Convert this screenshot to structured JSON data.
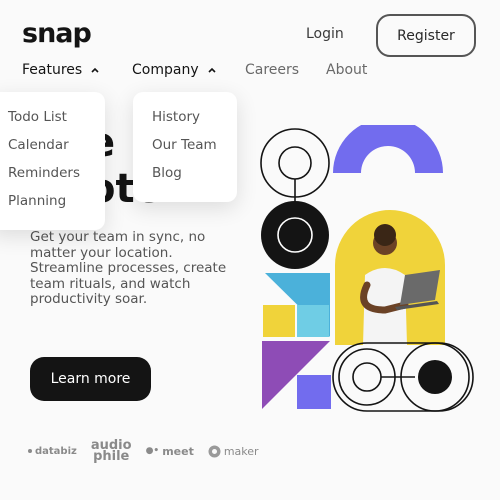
{
  "header": {
    "logo": "snap",
    "nav": {
      "features": "Features",
      "company": "Company",
      "careers": "Careers",
      "about": "About"
    },
    "login": "Login",
    "register": "Register"
  },
  "features_menu": {
    "items": [
      {
        "label": "Todo List",
        "icon": "todo-icon",
        "color": "#726cee"
      },
      {
        "label": "Calendar",
        "icon": "calendar-icon",
        "color": "#4bb1da"
      },
      {
        "label": "Reminders",
        "icon": "reminders-icon",
        "color": "#edd556"
      },
      {
        "label": "Planning",
        "icon": "planning-icon",
        "color": "#8e4cb6"
      }
    ]
  },
  "company_menu": {
    "items": [
      {
        "label": "History"
      },
      {
        "label": "Our Team"
      },
      {
        "label": "Blog"
      }
    ]
  },
  "hero": {
    "title_line1": "e",
    "title_line2": "ote",
    "paragraph": "Get your team in sync, no matter your location. Streamline processes, create team rituals, and watch productivity soar.",
    "cta": "Learn more"
  },
  "clients": {
    "databiz": "databiz",
    "audiophile_top": "audio",
    "audiophile_bottom": "phile",
    "meet": "meet",
    "maker": "maker"
  },
  "colors": {
    "dark": "#141414",
    "purple": "#726cee",
    "yellow": "#f0d33a",
    "cyan": "#4bb1da",
    "violet": "#8e4cb6"
  }
}
